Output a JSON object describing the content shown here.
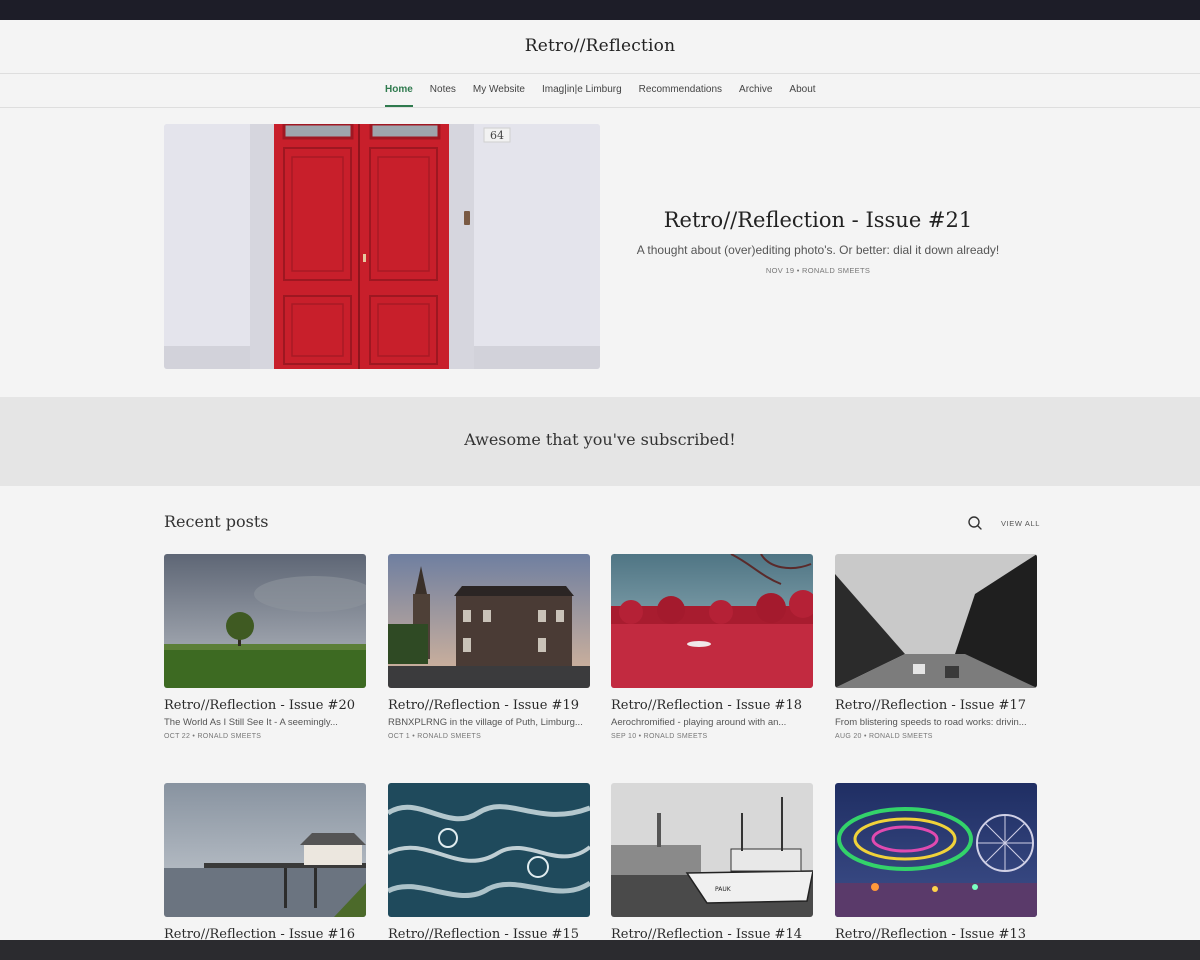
{
  "site": {
    "title": "Retro//Reflection"
  },
  "nav": {
    "items": [
      {
        "label": "Home",
        "active": true
      },
      {
        "label": "Notes"
      },
      {
        "label": "My Website"
      },
      {
        "label": "Imag|in|e Limburg"
      },
      {
        "label": "Recommendations"
      },
      {
        "label": "Archive"
      },
      {
        "label": "About"
      }
    ]
  },
  "featured": {
    "title": "Retro//Reflection - Issue #21",
    "subtitle": "A thought about (over)editing photo's. Or better: dial it down already!",
    "date": "NOV 19",
    "author": "RONALD SMEETS",
    "house_number": "64"
  },
  "subscribe": {
    "message": "Awesome that you've subscribed!"
  },
  "recent": {
    "heading": "Recent posts",
    "view_all": "VIEW ALL",
    "posts": [
      {
        "title": "Retro//Reflection - Issue #20",
        "excerpt": "The World As I Still See It - A seemingly...",
        "date": "OCT 22",
        "author": "RONALD SMEETS"
      },
      {
        "title": "Retro//Reflection - Issue #19",
        "excerpt": "RBNXPLRNG in the village of Puth, Limburg...",
        "date": "OCT 1",
        "author": "RONALD SMEETS"
      },
      {
        "title": "Retro//Reflection - Issue #18",
        "excerpt": "Aerochromified - playing around with an...",
        "date": "SEP 10",
        "author": "RONALD SMEETS"
      },
      {
        "title": "Retro//Reflection - Issue #17",
        "excerpt": "From blistering speeds to road works: drivin...",
        "date": "AUG 20",
        "author": "RONALD SMEETS"
      },
      {
        "title": "Retro//Reflection - Issue #16"
      },
      {
        "title": "Retro//Reflection - Issue #15"
      },
      {
        "title": "Retro//Reflection - Issue #14"
      },
      {
        "title": "Retro//Reflection - Issue #13"
      }
    ]
  },
  "colors": {
    "accent": "#2f7a4e",
    "door_red": "#d42a31",
    "background": "#f4f4f4",
    "band": "#e5e5e5"
  }
}
